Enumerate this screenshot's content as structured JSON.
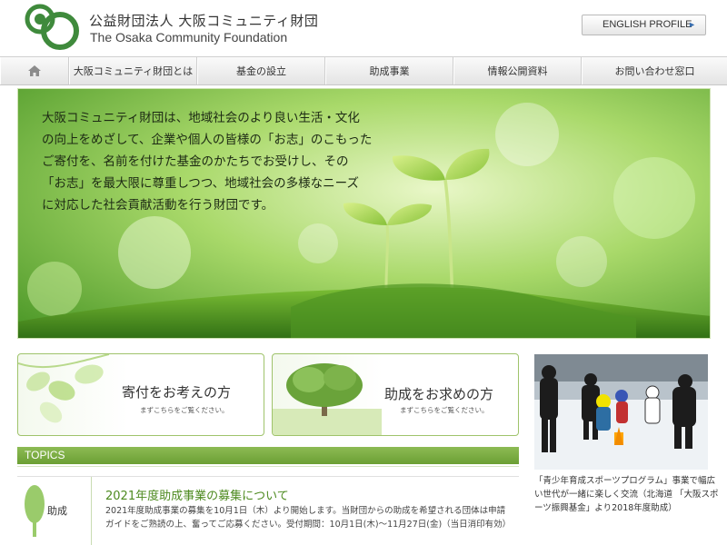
{
  "header": {
    "org_name_ja": "公益財団法人 大阪コミュニティ財団",
    "org_name_en": "The Osaka Community Foundation",
    "english_profile_label": "ENGLISH PROFILE",
    "english_profile_arrow": "►"
  },
  "nav": {
    "home_icon": "home-icon",
    "items": [
      {
        "label": "大阪コミュニティ財団とは"
      },
      {
        "label": "基金の設立"
      },
      {
        "label": "助成事業"
      },
      {
        "label": "情報公開資料"
      },
      {
        "label": "お問い合わせ窓口"
      }
    ]
  },
  "hero": {
    "lines": [
      "大阪コミュニティ財団は、地域社会のより良い生活・文化",
      "の向上をめざして、企業や個人の皆様の「お志」のこもった",
      "ご寄付を、名前を付けた基金のかたちでお受けし、その",
      "「お志」を最大限に尊重しつつ、地域社会の多様なニーズ",
      "に対応した社会貢献活動を行う財団です。"
    ]
  },
  "banners": [
    {
      "title": "寄付をお考えの方",
      "subtitle": "まずこちらをご覧ください。"
    },
    {
      "title": "助成をお求めの方",
      "subtitle": "まずこちらをご覧ください。"
    }
  ],
  "topics": {
    "header": "TOPICS",
    "items": [
      {
        "category": "助成",
        "title": "2021年度助成事業の募集について",
        "body": "2021年度助成事業の募集を10月1日（木）より開始します。当財団からの助成を希望される団体は申請ガイドをご熟読の上、奮ってご応募ください。受付期間：10月1日(木)～11月27日(金)（当日消印有効）"
      }
    ]
  },
  "sidebar": {
    "photo_caption": "「青少年育成スポーツプログラム」事業で幅広い世代が一緒に楽しく交流（北海道 「大阪スポーツ振興基金」より2018年度助成）"
  },
  "colors": {
    "brand_green": "#3f8a3c",
    "topics_bar": "#7aab40",
    "link_green": "#4d8a1f"
  }
}
